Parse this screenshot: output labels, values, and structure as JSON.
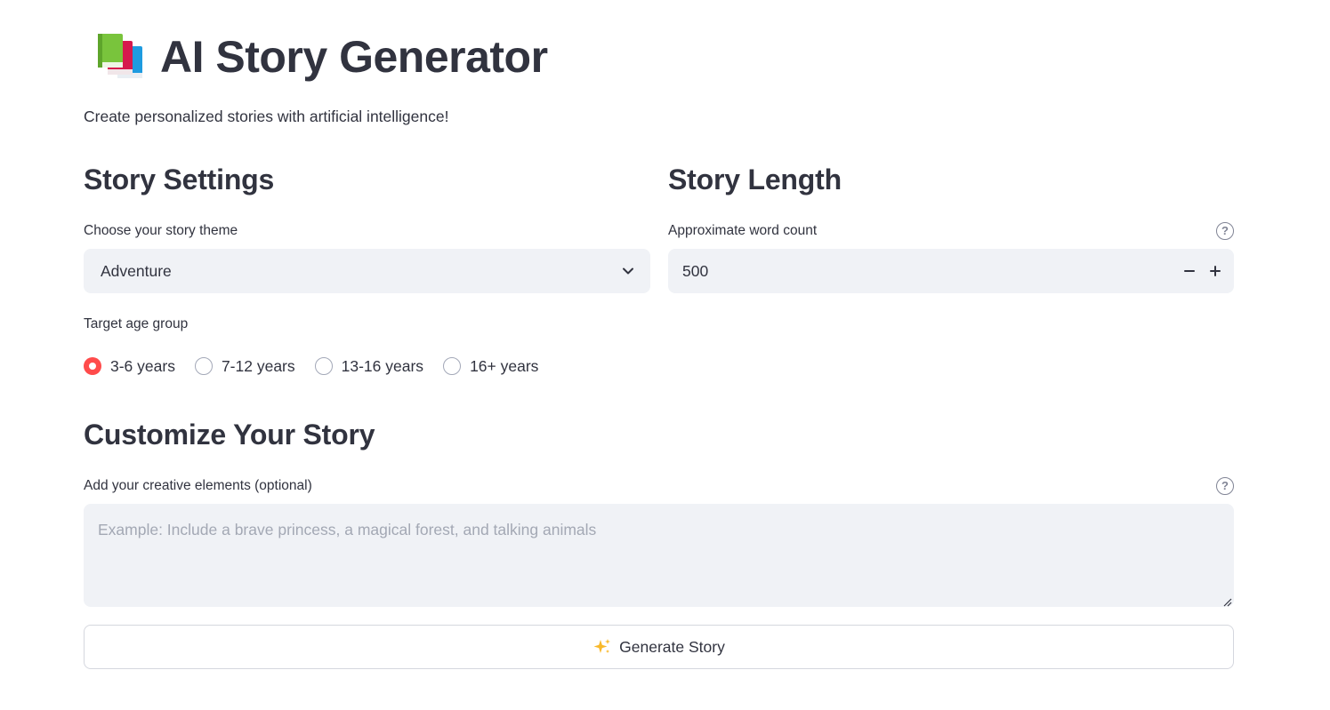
{
  "header": {
    "icon": "books-icon",
    "title": "AI Story Generator",
    "subtitle": "Create personalized stories with artificial intelligence!"
  },
  "story_settings": {
    "heading": "Story Settings",
    "theme": {
      "label": "Choose your story theme",
      "selected": "Adventure",
      "icon": "chevron-down-icon"
    },
    "age_group": {
      "label": "Target age group",
      "options": [
        "3-6 years",
        "7-12 years",
        "13-16 years",
        "16+ years"
      ],
      "selected_index": 0
    }
  },
  "story_length": {
    "heading": "Story Length",
    "word_count": {
      "label": "Approximate word count",
      "value": "500",
      "help_icon": "help-circle-icon",
      "decrement_icon": "minus-icon",
      "increment_icon": "plus-icon"
    }
  },
  "customize": {
    "heading": "Customize Your Story",
    "creative_elements": {
      "label": "Add your creative elements (optional)",
      "placeholder": "Example: Include a brave princess, a magical forest, and talking animals",
      "value": "",
      "help_icon": "help-circle-icon"
    }
  },
  "generate_button": {
    "icon": "sparkles-icon",
    "label": "Generate Story"
  },
  "colors": {
    "accent": "#ff4b4b",
    "text": "#31333f",
    "input_bg": "#f0f2f6",
    "border": "#d5d7de"
  }
}
